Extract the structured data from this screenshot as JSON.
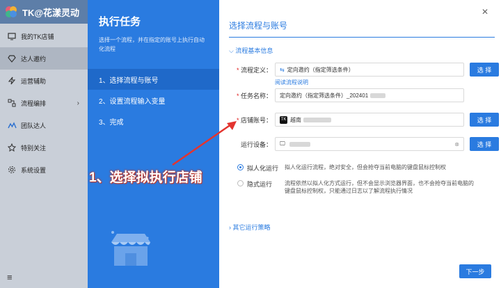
{
  "app": {
    "name": "TK@花漾灵动"
  },
  "sidebar": {
    "items": [
      {
        "label": "我的TK店铺",
        "icon": "monitor-icon"
      },
      {
        "label": "达人邀约",
        "icon": "diamond-icon"
      },
      {
        "label": "运营辅助",
        "icon": "lightning-icon"
      },
      {
        "label": "流程编排",
        "icon": "flow-icon"
      },
      {
        "label": "团队达人",
        "icon": "team-icon"
      },
      {
        "label": "特别关注",
        "icon": "star-icon"
      },
      {
        "label": "系统设置",
        "icon": "gear-icon"
      }
    ],
    "active_index": 1,
    "bottom_icon": "menu-icon"
  },
  "task_panel": {
    "title": "执行任务",
    "description": "选择一个流程，并在指定的账号上执行自动化流程",
    "steps": [
      "1、选择流程与账号",
      "2、设置流程输入变量",
      "3、完成"
    ],
    "active_step": 0
  },
  "form": {
    "title": "选择流程与账号",
    "section": "流程基本信息",
    "flow_def_label": "流程定义：",
    "flow_def_value": "定向邀约（指定筛选条件）",
    "read_doc_link": "阅读流程说明",
    "task_name_label": "任务名称：",
    "task_name_value": "定向邀约（指定筛选条件）_202401",
    "shop_account_label": "店铺账号：",
    "shop_account_value": "越南",
    "run_device_label": "运行设备：",
    "select_btn": "选 择",
    "modes": [
      {
        "label": "拟人化运行",
        "desc": "拟人化运行流程，绝对安全，但会抢夺当前电脑的键盘鼠标控制权",
        "selected": true
      },
      {
        "label": "隐式运行",
        "desc": "流程依然以拟人化方式运行，但不会显示浏览器界面，也不会抢夺当前电脑的键盘鼠标控制权，只能通过日志以了解流程执行情况",
        "selected": false
      }
    ],
    "other_strategy": "其它运行策略",
    "next_btn": "下一步"
  },
  "annotation": {
    "text": "1、选择拟执行店铺"
  }
}
